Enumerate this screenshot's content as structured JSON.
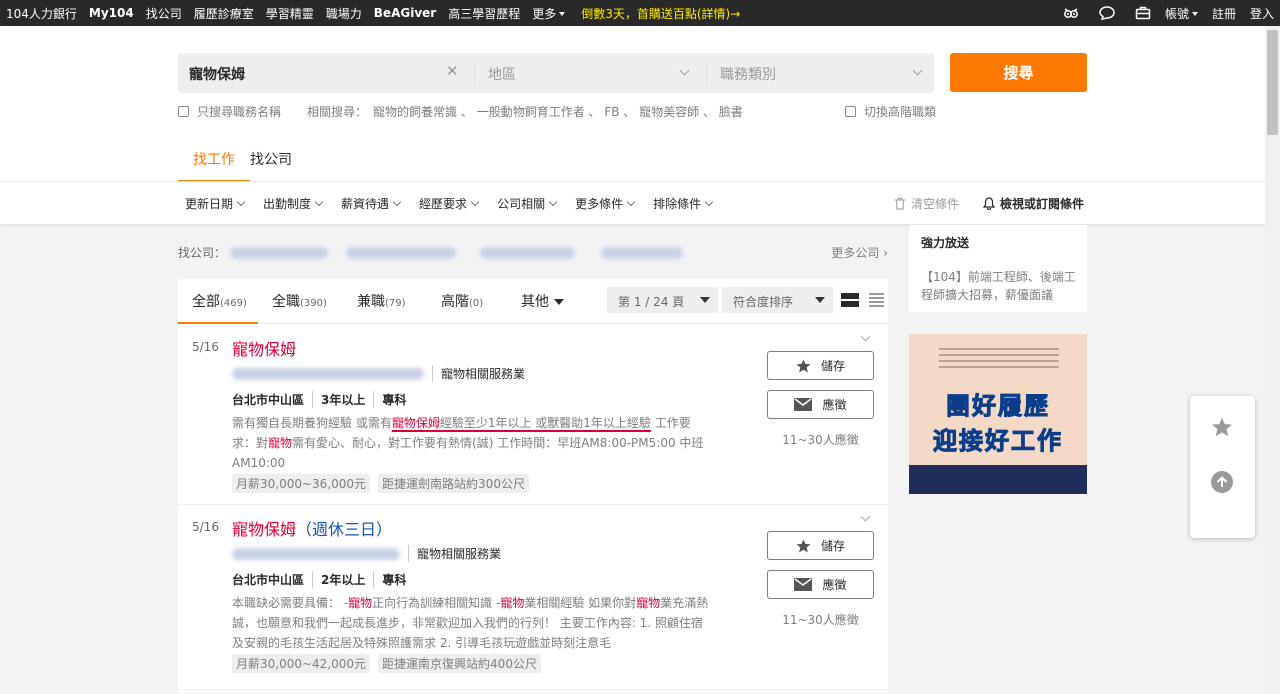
{
  "topbar": {
    "nav": [
      "104人力銀行",
      "My104",
      "找公司",
      "履歷診療室",
      "學習精靈",
      "職場力",
      "BeAGiver",
      "高三學習歷程"
    ],
    "more": "更多",
    "promo": "倒數3天，首購送百點(詳情)→",
    "account": "帳號",
    "register": "註冊",
    "login": "登入"
  },
  "search": {
    "keyword": "寵物保姆",
    "area_placeholder": "地區",
    "category_placeholder": "職務類別",
    "button": "搜尋",
    "only_title": "只搜尋職務名稱",
    "related_label": "相關搜尋：",
    "related": [
      "寵物的飼養常識",
      "一般動物飼育工作者",
      "FB",
      "寵物美容師",
      "臉書"
    ],
    "advanced": "切換高階職類"
  },
  "tabs": {
    "jobs": "找工作",
    "companies": "找公司"
  },
  "filters": [
    "更新日期",
    "出勤制度",
    "薪資待遇",
    "經歷要求",
    "公司相關",
    "更多條件",
    "排除條件"
  ],
  "clear_filters": "清空條件",
  "subscribe": "檢視或訂閱條件",
  "company_strip": {
    "label": "找公司：",
    "more": "更多公司"
  },
  "list_tabs": [
    {
      "label": "全部",
      "count": "(469)"
    },
    {
      "label": "全職",
      "count": "(390)"
    },
    {
      "label": "兼職",
      "count": "(79)"
    },
    {
      "label": "高階",
      "count": "(0)"
    },
    {
      "label": "其他",
      "count": ""
    }
  ],
  "page_select": "第 1 / 24 頁",
  "sort_select": "符合度排序",
  "jobs": [
    {
      "date": "5/16",
      "title": "寵物保姆",
      "industry": "寵物相關服務業",
      "location": "台北市中山區",
      "experience": "3年以上",
      "education": "專科",
      "salary": "月薪30,000~36,000元",
      "distance": "距捷運劍南路站約300公尺",
      "save": "儲存",
      "apply": "應徵",
      "applicants": "11~30人應徵"
    },
    {
      "date": "5/16",
      "title": "寵物保姆",
      "title_extra": "（週休三日）",
      "industry": "寵物相關服務業",
      "location": "台北市中山區",
      "experience": "2年以上",
      "education": "專科",
      "salary": "月薪30,000~42,000元",
      "distance": "距捷運南京復興站約400公尺",
      "save": "儲存",
      "apply": "應徵",
      "applicants": "11~30人應徵"
    }
  ],
  "sidebar": {
    "title": "強力放送",
    "ad": "【104】前端工程師、後端工程師擴大招募，薪優面議"
  },
  "banner": {
    "line1": "團好履歷",
    "line2": "迎接好工作"
  },
  "colors": {
    "accent": "#ff7800",
    "highlight": "#e3003a",
    "topbar": "#292929"
  }
}
